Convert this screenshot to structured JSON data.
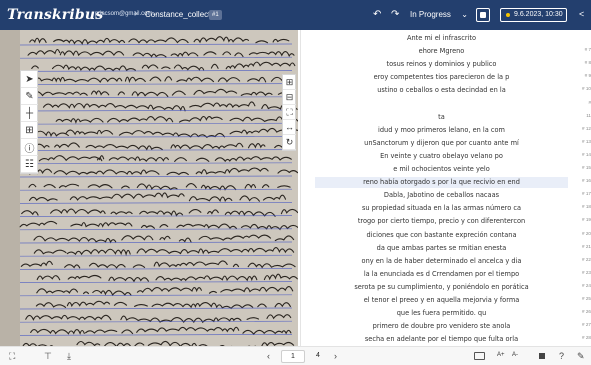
{
  "header": {
    "logo": "Transkribus",
    "user": "p.jacsom@gmail.com...",
    "breadcrumb_separator": "›",
    "collection": "Constance_collection",
    "collection_badge": "#1",
    "undo_icon": "undo-icon",
    "redo_icon": "redo-icon",
    "status": "In Progress",
    "status_chevron_icon": "chevron-down-icon",
    "save_icon": "save-icon",
    "date": "9.6.2023, 10:30",
    "status_dot_color": "#f5c400",
    "share_icon": "share-icon"
  },
  "image_tools_left": [
    {
      "name": "select-tool",
      "glyph": "➤"
    },
    {
      "name": "draw-tool",
      "glyph": "✎"
    },
    {
      "name": "split-tool",
      "glyph": "┼"
    },
    {
      "name": "grid-tool",
      "glyph": "⊞"
    },
    {
      "name": "info-tool",
      "glyph": "ⓘ"
    },
    {
      "name": "list-tool",
      "glyph": "☷"
    }
  ],
  "image_tools_right": [
    {
      "name": "zoom-in-icon",
      "glyph": "⊞"
    },
    {
      "name": "zoom-out-icon",
      "glyph": "⊟"
    },
    {
      "name": "fit-screen-icon",
      "glyph": "⛶"
    },
    {
      "name": "fit-width-icon",
      "glyph": "↔"
    },
    {
      "name": "rotate-icon",
      "glyph": "↻"
    }
  ],
  "transcription": {
    "lines": [
      {
        "text": "Ante mi el infrascrito",
        "num": "",
        "hl": false
      },
      {
        "text": "ehore Mgreno",
        "num": "# 7",
        "hl": false
      },
      {
        "text": "tosus reinos y dominios y publico",
        "num": "# 8",
        "hl": false
      },
      {
        "text": "eroy competentes tios parecieron de la p",
        "num": "# 9",
        "hl": false
      },
      {
        "text": "ustino o ceballos o esta decindad en la",
        "num": "# 10",
        "hl": false
      },
      {
        "text": "",
        "num": "#",
        "hl": false
      },
      {
        "text": "ta",
        "num": "11",
        "hl": false
      },
      {
        "text": "idud y moo primeros lelano, en la com",
        "num": "# 12",
        "hl": false
      },
      {
        "text": "unSanctorum y dijeron que por cuanto ante mí",
        "num": "# 13",
        "hl": false
      },
      {
        "text": "En veinte y cuatro obelayo velano po",
        "num": "# 14",
        "hl": false
      },
      {
        "text": "e mil ochocientos veinte yelo",
        "num": "# 15",
        "hl": false
      },
      {
        "text": "reno había otorgado s por la que recivio en end",
        "num": "# 16",
        "hl": true
      },
      {
        "text": "Dabla, Jabotino de ceballos nacaas",
        "num": "# 17",
        "hl": false
      },
      {
        "text": "su propiedad situada en la las armas número ca",
        "num": "# 18",
        "hl": false
      },
      {
        "text": "trogo por cierto tiempo, precio y con diferentercon",
        "num": "# 19",
        "hl": false
      },
      {
        "text": "diciones que con bastante expreción contana",
        "num": "# 20",
        "hl": false
      },
      {
        "text": "da que ambas partes se rmitian enesta",
        "num": "# 21",
        "hl": false
      },
      {
        "text": "ony en la de haber determinado el ancelca y dia",
        "num": "# 22",
        "hl": false
      },
      {
        "text": "la la enunciada es d Crrendamen por el tiempo",
        "num": "# 23",
        "hl": false
      },
      {
        "text": "serota pe su cumplimiento, y poniéndolo en porática",
        "num": "# 24",
        "hl": false
      },
      {
        "text": "el tenor el preeo y en aquella mejorvia y forma",
        "num": "# 25",
        "hl": false
      },
      {
        "text": "que les fuera permitido. qu",
        "num": "# 26",
        "hl": false
      },
      {
        "text": "primero de doubre pro venidero ste anola",
        "num": "# 27",
        "hl": false
      },
      {
        "text": "secha en adelante por el tiempo que fulta orla",
        "num": "# 28",
        "hl": false
      }
    ]
  },
  "footer": {
    "expand_icon": "expand-icon",
    "compare_icon": "compare-icon",
    "download_icon": "download-icon",
    "prev_icon": "chevron-left-icon",
    "page_current": "1",
    "page_total": "4",
    "next_icon": "chevron-right-icon",
    "keyboard_icon": "keyboard-icon",
    "font_increase": "A+",
    "font_decrease": "A-",
    "layout_icon": "layout-icon",
    "help_icon": "help-icon",
    "tools_icon": "tools-icon"
  },
  "colors": {
    "topbar": "#233f6e",
    "highlight": "#e9eef8",
    "ink": "#2a2520",
    "baseline": "#3d4fc4"
  }
}
